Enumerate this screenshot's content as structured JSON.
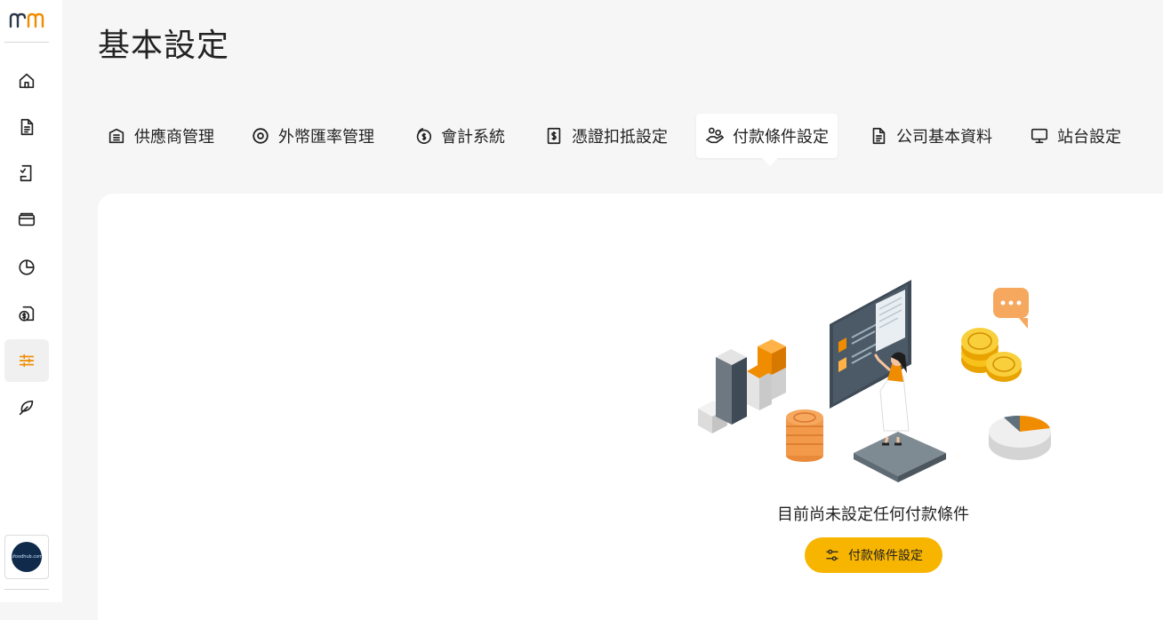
{
  "page": {
    "title": "基本設定"
  },
  "sidebar": {
    "logo_icon": "mm-logo",
    "items": [
      {
        "icon": "home-icon",
        "active": false
      },
      {
        "icon": "document-icon",
        "active": false
      },
      {
        "icon": "checklist-document-icon",
        "active": false
      },
      {
        "icon": "wallet-icon",
        "active": false
      },
      {
        "icon": "pie-chart-icon",
        "active": false
      },
      {
        "icon": "dollar-document-icon",
        "active": false
      },
      {
        "icon": "sliders-icon",
        "active": true
      },
      {
        "icon": "leaf-icon",
        "active": false
      }
    ],
    "avatar_text": "ufoodhub.com"
  },
  "tabs": [
    {
      "label": "供應商管理",
      "icon": "bank-icon",
      "active": false
    },
    {
      "label": "外幣匯率管理",
      "icon": "target-icon",
      "active": false
    },
    {
      "label": "會計系統",
      "icon": "coins-icon",
      "active": false
    },
    {
      "label": "憑證扣抵設定",
      "icon": "dollar-receipt-icon",
      "active": false
    },
    {
      "label": "付款條件設定",
      "icon": "hand-coins-icon",
      "active": true
    },
    {
      "label": "公司基本資料",
      "icon": "file-icon",
      "active": false
    },
    {
      "label": "站台設定",
      "icon": "monitor-icon",
      "active": false
    }
  ],
  "empty_state": {
    "message": "目前尚未設定任何付款條件",
    "button_label": "付款條件設定",
    "button_icon": "sliders-icon"
  },
  "colors": {
    "accent": "#f7b500",
    "active_icon": "#f08c00",
    "background": "#f6f6f6",
    "panel": "#ffffff"
  }
}
